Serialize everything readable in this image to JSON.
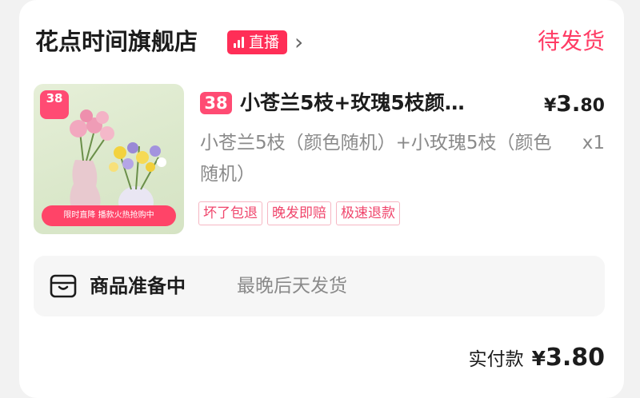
{
  "shop": {
    "name": "花点时间旗舰店",
    "live_label": "直播",
    "status": "待发货"
  },
  "product": {
    "tag": "38",
    "image_tag_label": "38",
    "image_banner": "限时直降 播款火热抢购中",
    "title": "小苍兰5枝+玫瑰5枝颜…",
    "price_currency": "¥",
    "price_int": "3.",
    "price_dec": "80",
    "spec": "小苍兰5枝（颜色随机）+小玫瑰5枝（颜色随机）",
    "quantity": "x1",
    "service_tags": [
      "坏了包退",
      "晚发即赔",
      "极速退款"
    ]
  },
  "prep": {
    "icon": "package-icon",
    "title": "商品准备中",
    "subtitle": "最晚后天发货"
  },
  "total": {
    "label": "实付款",
    "currency": "¥",
    "amount": "3.80"
  },
  "colors": {
    "accent": "#ff3b64",
    "tag_border": "#f6b7c3",
    "muted_text": "#8a8a8a"
  }
}
